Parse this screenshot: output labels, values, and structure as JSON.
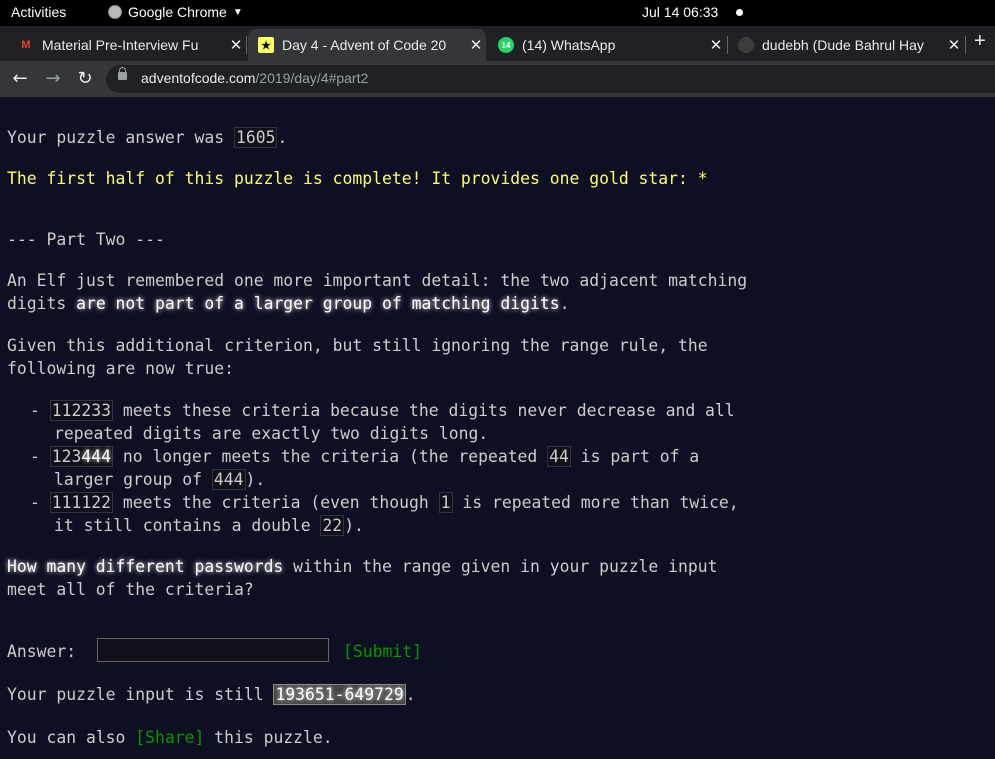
{
  "topbar": {
    "activities": "Activities",
    "app": "Google Chrome",
    "clock": "Jul 14  06:33"
  },
  "tabs": [
    {
      "title": "Material Pre-Interview Fu",
      "favicon": "M"
    },
    {
      "title": "Day 4 - Advent of Code 20",
      "favicon": "★"
    },
    {
      "title": "(14) WhatsApp",
      "favicon": "14"
    },
    {
      "title": "dudebh (Dude Bahrul Hay",
      "favicon": "gh"
    }
  ],
  "address": {
    "host": "adventofcode.com",
    "path": "/2019/day/4#part2"
  },
  "page": {
    "answer_was_prefix": "Your puzzle answer was ",
    "answer_was_value": "1605",
    "answer_was_suffix": ".",
    "first_half": "The first half of this puzzle is complete! It provides one gold star: ",
    "star": "*",
    "part_two": "--- Part Two ---",
    "p1_line1": "An Elf just remembered one more important detail: the two adjacent matching",
    "p1_line2_pre": "digits ",
    "p1_line2_em": "are not part of a larger group of matching digits",
    "p1_line2_post": ".",
    "p2_line1": "Given this additional criterion, but still ignoring the range rule, the",
    "p2_line2": "following are now true:",
    "li1_code": "112233",
    "li1_text": " meets these criteria because the digits never decrease and all",
    "li1_line2": "repeated digits are exactly two digits long.",
    "li2_code_a": "123",
    "li2_code_b": "444",
    "li2_text": " no longer meets the criteria (the repeated ",
    "li2_code2": "44",
    "li2_text2": " is part of a",
    "li2_line2_pre": "larger group of ",
    "li2_code3": "444",
    "li2_line2_post": ").",
    "li3_code": "111122",
    "li3_text": " meets the criteria (even though ",
    "li3_code2": "1",
    "li3_text2": " is repeated more than twice,",
    "li3_line2_pre": "it still contains a double ",
    "li3_code3": "22",
    "li3_line2_post": ").",
    "q_em": "How many different passwords",
    "q_rest": " within the range given in your puzzle input",
    "q_line2": "meet all of the criteria?",
    "answer_label": "Answer: ",
    "submit": "[Submit]",
    "input_pre": "Your puzzle input is still ",
    "input_value": "193651-649729",
    "input_post": ".",
    "share_pre": "You can also ",
    "share": "[Share]",
    "share_post": " this puzzle."
  }
}
